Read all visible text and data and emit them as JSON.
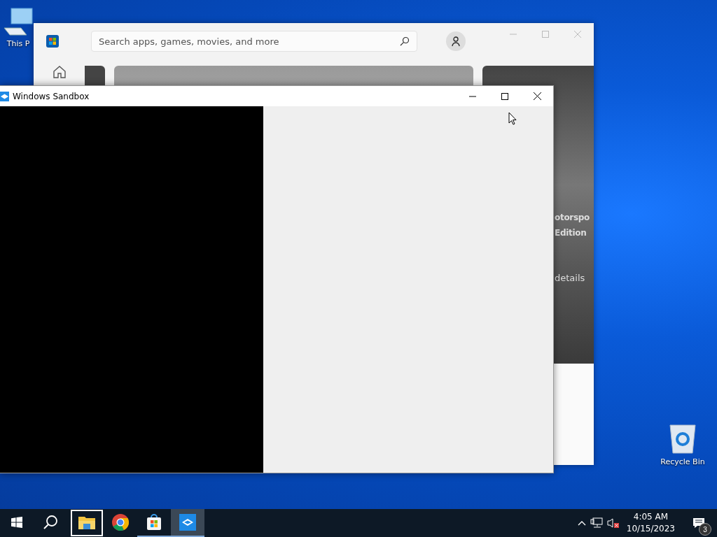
{
  "desktop_icons": [
    {
      "kind": "computer",
      "label": "This P"
    },
    {
      "kind": "recycle",
      "label": "Recycle Bin"
    }
  ],
  "store_window": {
    "search": {
      "placeholder": "Search apps, games, movies, and more"
    },
    "hero": {
      "title_lines": [
        "otorspo",
        "Edition"
      ],
      "link": "details"
    }
  },
  "sandbox_window": {
    "title": "Windows Sandbox"
  },
  "taskbar": {
    "apps": [
      {
        "kind": "explorer",
        "focused": true,
        "running": false,
        "selected": false
      },
      {
        "kind": "chrome",
        "focused": false,
        "running": false,
        "selected": false
      },
      {
        "kind": "store",
        "focused": false,
        "running": true,
        "selected": false
      },
      {
        "kind": "sandbox",
        "focused": false,
        "running": true,
        "selected": true
      }
    ],
    "tray": {
      "volume_muted": true,
      "time": "4:05 AM",
      "date": "10/15/2023",
      "notifications": "3"
    }
  }
}
